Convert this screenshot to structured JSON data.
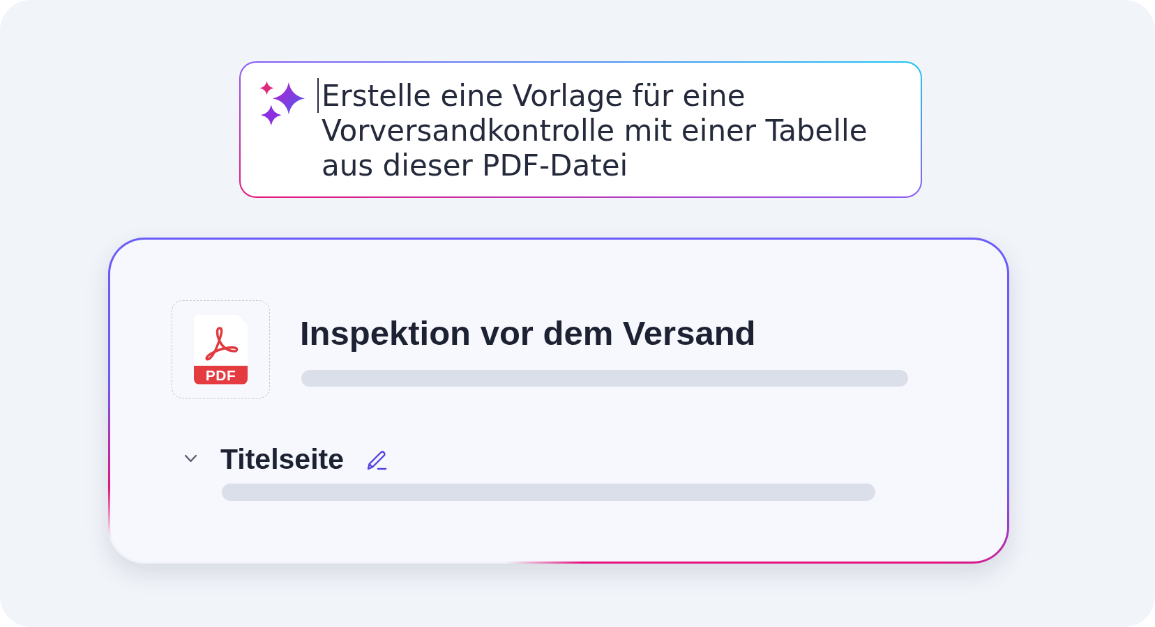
{
  "prompt": {
    "value": "Erstelle eine Vorlage für eine Vorversandkontrolle mit einer Tabelle aus dieser PDF-Datei",
    "focused": true
  },
  "document": {
    "file_type": "PDF",
    "title": "Inspektion vor dem Versand",
    "sections": [
      {
        "title": "Titelseite",
        "expanded": true
      }
    ]
  }
}
